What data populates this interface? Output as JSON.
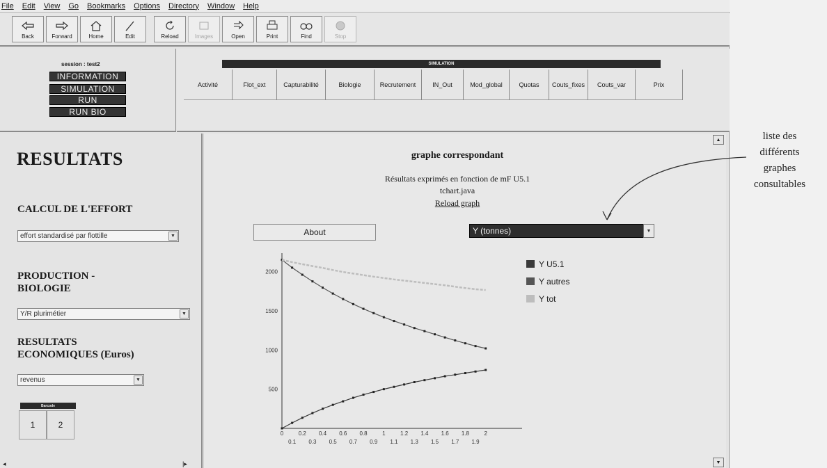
{
  "menu": [
    "File",
    "Edit",
    "View",
    "Go",
    "Bookmarks",
    "Options",
    "Directory",
    "Window",
    "Help"
  ],
  "toolbar": [
    {
      "label": "Back",
      "icon": "back-icon",
      "enabled": true
    },
    {
      "label": "Forward",
      "icon": "forward-icon",
      "enabled": true
    },
    {
      "label": "Home",
      "icon": "home-icon",
      "enabled": true
    },
    {
      "label": "Edit",
      "icon": "edit-icon",
      "enabled": true
    },
    {
      "label": "Reload",
      "icon": "reload-icon",
      "enabled": true
    },
    {
      "label": "Images",
      "icon": "images-icon",
      "enabled": false
    },
    {
      "label": "Open",
      "icon": "open-icon",
      "enabled": true
    },
    {
      "label": "Print",
      "icon": "print-icon",
      "enabled": true
    },
    {
      "label": "Find",
      "icon": "find-icon",
      "enabled": true
    },
    {
      "label": "Stop",
      "icon": "stop-icon",
      "enabled": false
    }
  ],
  "session": {
    "title": "session : test2",
    "buttons": [
      "INFORMATION",
      "SIMULATION",
      "RUN",
      "RUN BIO"
    ]
  },
  "simulation": {
    "header": "SIMULATION",
    "tabs": [
      "Activité",
      "Flot_ext",
      "Capturabilité",
      "Biologie",
      "Recrutement",
      "IN_Out",
      "Mod_global",
      "Quotas",
      "Couts_fixes",
      "Couts_var",
      "Prix"
    ]
  },
  "left": {
    "title": "RESULTATS",
    "effort_heading": "CALCUL DE L'EFFORT",
    "effort_select": "effort standardisé par flottille",
    "production_heading_1": "PRODUCTION -",
    "production_heading_2": "BIOLOGIE",
    "production_select": "Y/R plurimétier",
    "eco_heading_1": "RESULTATS",
    "eco_heading_2": "ECONOMIQUES (Euros)",
    "eco_select": "revenus",
    "barcode_header": "Barcode",
    "pages": [
      "1",
      "2"
    ]
  },
  "main": {
    "graph_title": "graphe correspondant",
    "subtitle": "Résultats exprimés en fonction de mF U5.1",
    "applet": "tchart.java",
    "reload_link": "Reload graph",
    "about_button": "About",
    "graph_select": "Y (tonnes)"
  },
  "annotation": {
    "lines": [
      "liste des",
      "différents",
      "graphes",
      "consultables"
    ]
  },
  "chart_data": {
    "type": "line",
    "x": [
      0,
      0.1,
      0.2,
      0.3,
      0.4,
      0.5,
      0.6,
      0.7,
      0.8,
      0.9,
      1,
      1.1,
      1.2,
      1.3,
      1.4,
      1.5,
      1.6,
      1.7,
      1.8,
      1.9,
      2
    ],
    "xticks": [
      "0",
      "0.1",
      "0.2",
      "0.3",
      "0.4",
      "0.5",
      "0.6",
      "0.7",
      "0.8",
      "0.9",
      "1",
      "1.1",
      "1.2",
      "1.3",
      "1.4",
      "1.5",
      "1.6",
      "1.7",
      "1.8",
      "1.9",
      "2"
    ],
    "yticks": [
      500,
      1000,
      1500,
      2000
    ],
    "xlim": [
      0,
      2.05
    ],
    "ylim": [
      0,
      2200
    ],
    "series": [
      {
        "name": "Y U5.1",
        "color": "#3a3a3a",
        "values": [
          0,
          70,
          135,
          195,
          250,
          300,
          345,
          390,
          430,
          465,
          500,
          530,
          560,
          590,
          615,
          640,
          665,
          685,
          705,
          725,
          745
        ]
      },
      {
        "name": "Y autres",
        "color": "#555555",
        "values": [
          2150,
          2050,
          1960,
          1875,
          1795,
          1720,
          1650,
          1585,
          1525,
          1470,
          1418,
          1370,
          1325,
          1280,
          1240,
          1200,
          1160,
          1122,
          1085,
          1050,
          1020
        ]
      },
      {
        "name": "Y tot",
        "color": "#bdbdbd",
        "values": [
          2150,
          2120,
          2095,
          2070,
          2047,
          2020,
          1995,
          1975,
          1955,
          1935,
          1918,
          1900,
          1885,
          1870,
          1855,
          1840,
          1825,
          1807,
          1790,
          1775,
          1765
        ]
      }
    ]
  }
}
